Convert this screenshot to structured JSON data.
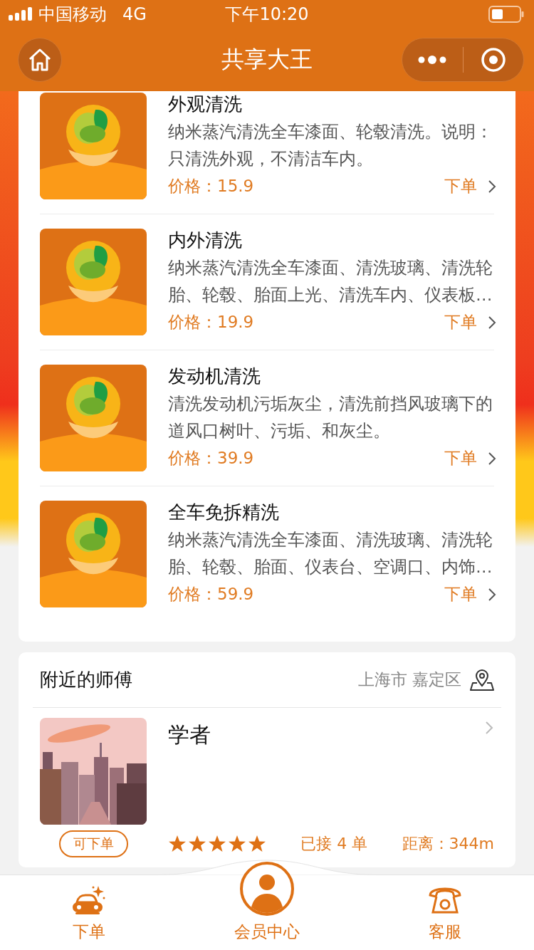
{
  "status_bar": {
    "carrier": "中国移动",
    "network": "4G",
    "time": "下午10:20"
  },
  "nav": {
    "title": "共享大王"
  },
  "services": [
    {
      "title": "外观清洗",
      "description": "纳米蒸汽清洗全车漆面、轮毂清洗。说明：只清洗外观，不清洁车内。",
      "price": "价格：15.9",
      "action": "下单"
    },
    {
      "title": "内外清洗",
      "description": "纳米蒸汽清洗全车漆面、清洗玻璃、清洗轮胎、轮毂、胎面上光、清洗车内、仪表板…",
      "price": "价格：19.9",
      "action": "下单"
    },
    {
      "title": "发动机清洗",
      "description": "清洗发动机污垢灰尘，清洗前挡风玻璃下的道风口树叶、污垢、和灰尘。",
      "price": "价格：39.9",
      "action": "下单"
    },
    {
      "title": "全车免拆精洗",
      "description": "纳米蒸汽清洗全车漆面、清洗玻璃、清洗轮胎、轮毂、胎面、仪表台、空调口、内饰…",
      "price": "价格：59.9",
      "action": "下单"
    }
  ],
  "nearby": {
    "title": "附近的师傅",
    "location": "上海市 嘉定区",
    "masters": [
      {
        "name": "学者",
        "status": "可下单",
        "stars": 5,
        "orders": "已接 4 单",
        "distance": "距离：344m"
      }
    ]
  },
  "tab_bar": [
    {
      "kind": "order",
      "label": "下单"
    },
    {
      "kind": "member",
      "label": "会员中心"
    },
    {
      "kind": "service",
      "label": "客服"
    }
  ]
}
